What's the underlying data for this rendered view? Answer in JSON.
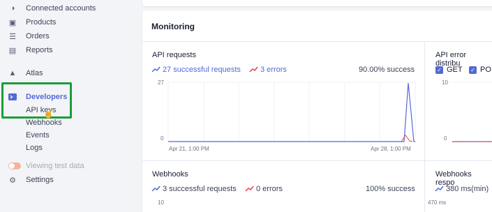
{
  "sidebar": {
    "items": [
      {
        "label": "Connected accounts",
        "icon": "connected-accounts-icon"
      },
      {
        "label": "Products",
        "icon": "products-icon"
      },
      {
        "label": "Orders",
        "icon": "orders-icon"
      },
      {
        "label": "Reports",
        "icon": "reports-icon"
      },
      {
        "label": "Atlas",
        "icon": "atlas-icon"
      },
      {
        "label": "Developers",
        "icon": "developers-icon"
      }
    ],
    "developer_subitems": [
      "API keys",
      "Webhooks",
      "Events",
      "Logs"
    ],
    "test_data_toggle": "Viewing test data",
    "settings": "Settings"
  },
  "monitoring": {
    "title": "Monitoring",
    "api_requests": {
      "title": "API requests",
      "successful": "27 successful requests",
      "errors": "3 errors",
      "success_rate": "90.00% success",
      "y_top": "27",
      "y_bottom": "0",
      "x_start": "Apr 21, 1:00 PM",
      "x_end": "Apr 28, 1:00 PM"
    },
    "api_error_distribution": {
      "title": "API error distribu",
      "filters": [
        "GET",
        "PO"
      ],
      "y_top": "10",
      "y_bottom": "0"
    },
    "webhooks": {
      "title": "Webhooks",
      "successful": "3 successful requests",
      "errors": "0 errors",
      "success_rate": "100% success",
      "y_top": "10"
    },
    "webhooks_response": {
      "title": "Webhooks respo",
      "value": "380 ms(min)",
      "y_top": "470 ms"
    }
  },
  "colors": {
    "accent": "#5469d4",
    "error": "#e5424d",
    "highlight_box": "#1a9d3a",
    "toggle": "#f4b49a"
  }
}
